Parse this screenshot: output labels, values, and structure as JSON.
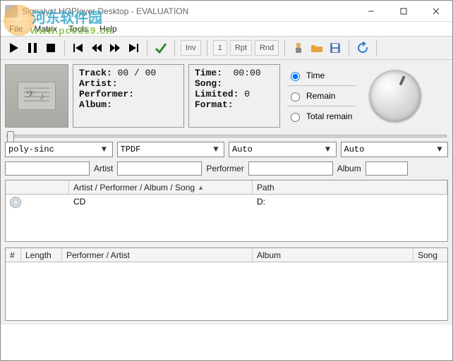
{
  "window": {
    "title": "Signalyst HQPlayer Desktop - EVALUATION"
  },
  "menu": {
    "file": "File",
    "matrix": "Matrix",
    "tools": "Tools",
    "help": "Help"
  },
  "toolbar": {
    "inv": "Inv",
    "mode_num": "1",
    "rpt": "Rpt",
    "rnd": "Rnd"
  },
  "panels": {
    "track_label": "Track:",
    "track_value": "00 / 00",
    "artist_label": "Artist:",
    "performer_label": "Performer:",
    "album_label": "Album:",
    "time_label": "Time:",
    "time_value": "00:00",
    "song_label": "Song:",
    "limited_label": "Limited:",
    "limited_value": "0",
    "format_label": "Format:"
  },
  "radios": {
    "time": "Time",
    "remain": "Remain",
    "total_remain": "Total remain"
  },
  "combos": {
    "filter": "poly-sinc",
    "dither": "TPDF",
    "rate": "Auto",
    "mode": "Auto"
  },
  "search": {
    "artist_label": "Artist",
    "performer_label": "Performer",
    "album_label": "Album",
    "f1": "",
    "f2": "",
    "f3": "",
    "f4": "",
    "f5": ""
  },
  "tree": {
    "col_blank": "",
    "col_main": "Artist / Performer / Album / Song",
    "col_path": "Path",
    "row0_main": "CD",
    "row0_path": "D:"
  },
  "table": {
    "col_no": "#",
    "col_length": "Length",
    "col_perf": "Performer / Artist",
    "col_album": "Album",
    "col_song": "Song"
  },
  "watermark": {
    "line1": "河东软件园",
    "line2": "www.pc0359.cn"
  }
}
